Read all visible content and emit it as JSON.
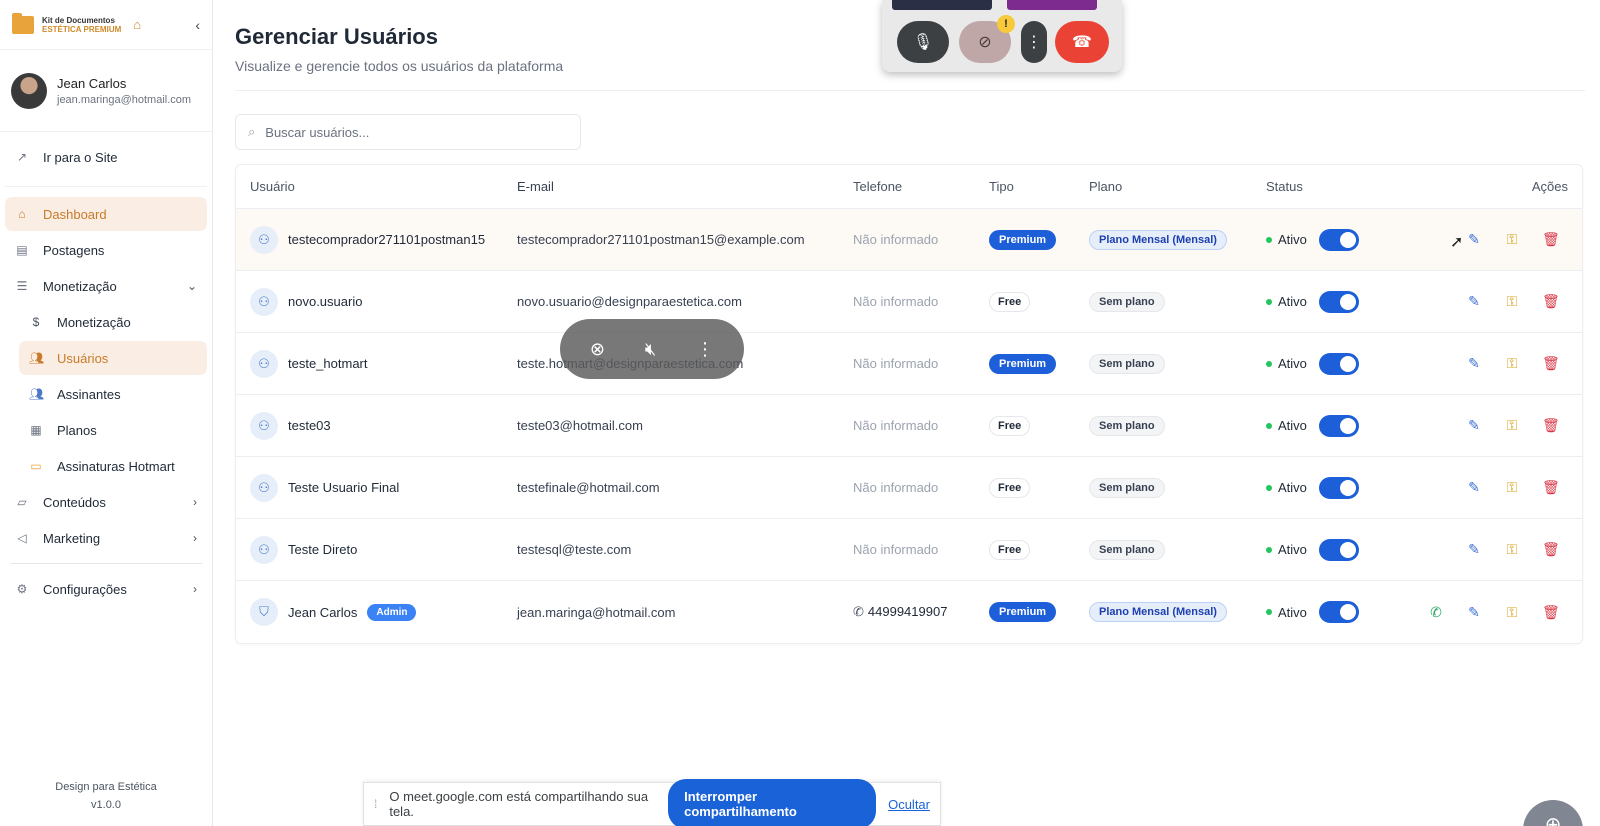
{
  "brand": {
    "line1": "Kit de Documentos",
    "line2": "ESTÉTICA PREMIUM",
    "accent": "#e8a33b"
  },
  "user": {
    "name": "Jean Carlos",
    "email": "jean.maringa@hotmail.com"
  },
  "sidebar": {
    "site_link": "Ir para o Site",
    "items": [
      {
        "label": "Dashboard",
        "icon": "home-icon",
        "active": true
      },
      {
        "label": "Postagens",
        "icon": "document-icon"
      },
      {
        "label": "Monetização",
        "icon": "database-icon",
        "expanded": true
      }
    ],
    "sub_items": [
      {
        "label": "Monetização",
        "icon": "dollar-icon"
      },
      {
        "label": "Usuários",
        "icon": "users-icon",
        "active": true
      },
      {
        "label": "Assinantes",
        "icon": "users-icon"
      },
      {
        "label": "Planos",
        "icon": "layout-icon"
      },
      {
        "label": "Assinaturas Hotmart",
        "icon": "card-icon"
      }
    ],
    "items_after": [
      {
        "label": "Conteúdos",
        "icon": "folder-icon"
      },
      {
        "label": "Marketing",
        "icon": "megaphone-icon"
      }
    ],
    "settings": {
      "label": "Configurações",
      "icon": "gear-icon"
    },
    "footer": {
      "name": "Design para Estética",
      "version": "v1.0.0"
    }
  },
  "page": {
    "title": "Gerenciar Usuários",
    "subtitle": "Visualize e gerencie todos os usuários da plataforma",
    "search_placeholder": "Buscar usuários..."
  },
  "table": {
    "columns": [
      "Usuário",
      "E-mail",
      "Telefone",
      "Tipo",
      "Plano",
      "Status",
      "Ações"
    ],
    "rows": [
      {
        "name": "testecomprador271101postman15",
        "email": "testecomprador271101postman15@example.com",
        "phone": "Não informado",
        "tipo": "Premium",
        "plano": "Plano Mensal (Mensal)",
        "status": "Ativo"
      },
      {
        "name": "novo.usuario",
        "email": "novo.usuario@designparaestetica.com",
        "phone": "Não informado",
        "tipo": "Free",
        "plano": "Sem plano",
        "status": "Ativo"
      },
      {
        "name": "teste_hotmart",
        "email": "teste.hotmart@designparaestetica.com",
        "phone": "Não informado",
        "tipo": "Premium",
        "plano": "Sem plano",
        "status": "Ativo"
      },
      {
        "name": "teste03",
        "email": "teste03@hotmail.com",
        "phone": "Não informado",
        "tipo": "Free",
        "plano": "Sem plano",
        "status": "Ativo"
      },
      {
        "name": "Teste Usuario Final",
        "email": "testefinale@hotmail.com",
        "phone": "Não informado",
        "tipo": "Free",
        "plano": "Sem plano",
        "status": "Ativo"
      },
      {
        "name": "Teste Direto",
        "email": "testesql@teste.com",
        "phone": "Não informado",
        "tipo": "Free",
        "plano": "Sem plano",
        "status": "Ativo"
      },
      {
        "name": "Jean Carlos",
        "admin_badge": "Admin",
        "email": "jean.maringa@hotmail.com",
        "phone": "44999419907",
        "tipo": "Premium",
        "plano": "Plano Mensal (Mensal)",
        "status": "Ativo"
      }
    ]
  },
  "meet_share": {
    "message": "O meet.google.com está compartilhando sua tela.",
    "stop_label": "Interromper compartilhamento",
    "hide_label": "Ocultar"
  },
  "colors": {
    "primary": "#1d5fd8",
    "active_bg": "#faeee4",
    "active_text": "#c97a2a",
    "danger": "#dc3545",
    "success": "#22c55e"
  }
}
